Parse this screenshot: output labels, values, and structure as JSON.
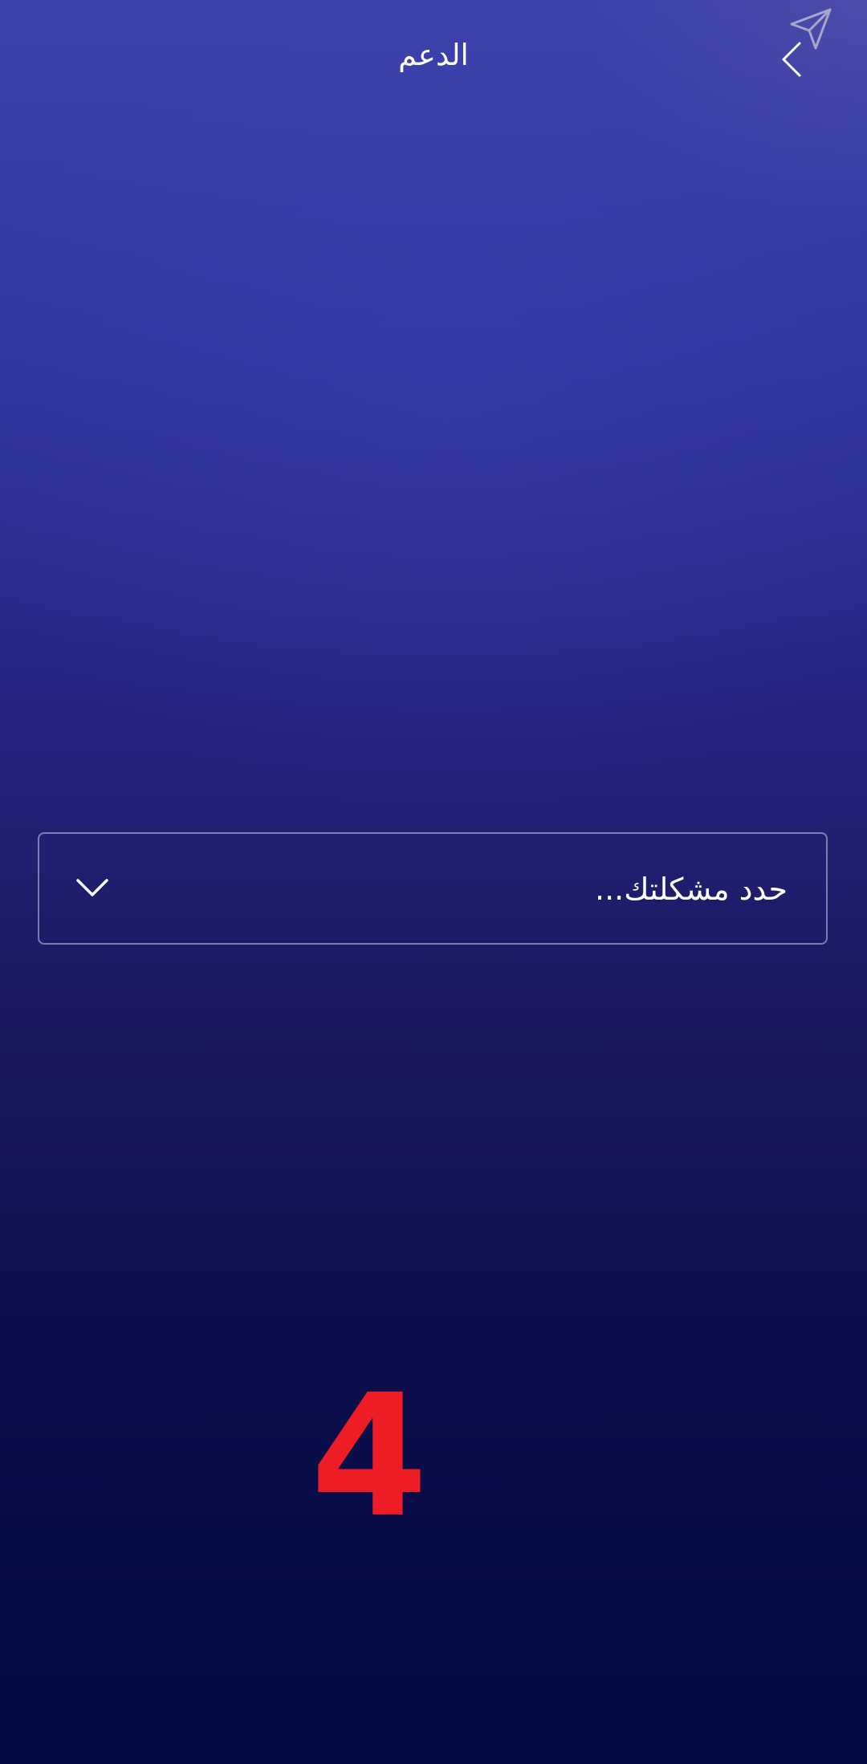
{
  "header": {
    "title": "الدعم",
    "back_icon": "chevron-left-icon",
    "send_icon": "paper-plane-icon"
  },
  "issue_select": {
    "placeholder": "حدد مشكلتك...",
    "dropdown_icon": "chevron-down-icon"
  },
  "overlay": {
    "step_number": "4",
    "color": "#ee1c25"
  },
  "colors": {
    "background_top": "#3e42ac",
    "background_bottom": "#030a44",
    "text": "#ffffff"
  }
}
